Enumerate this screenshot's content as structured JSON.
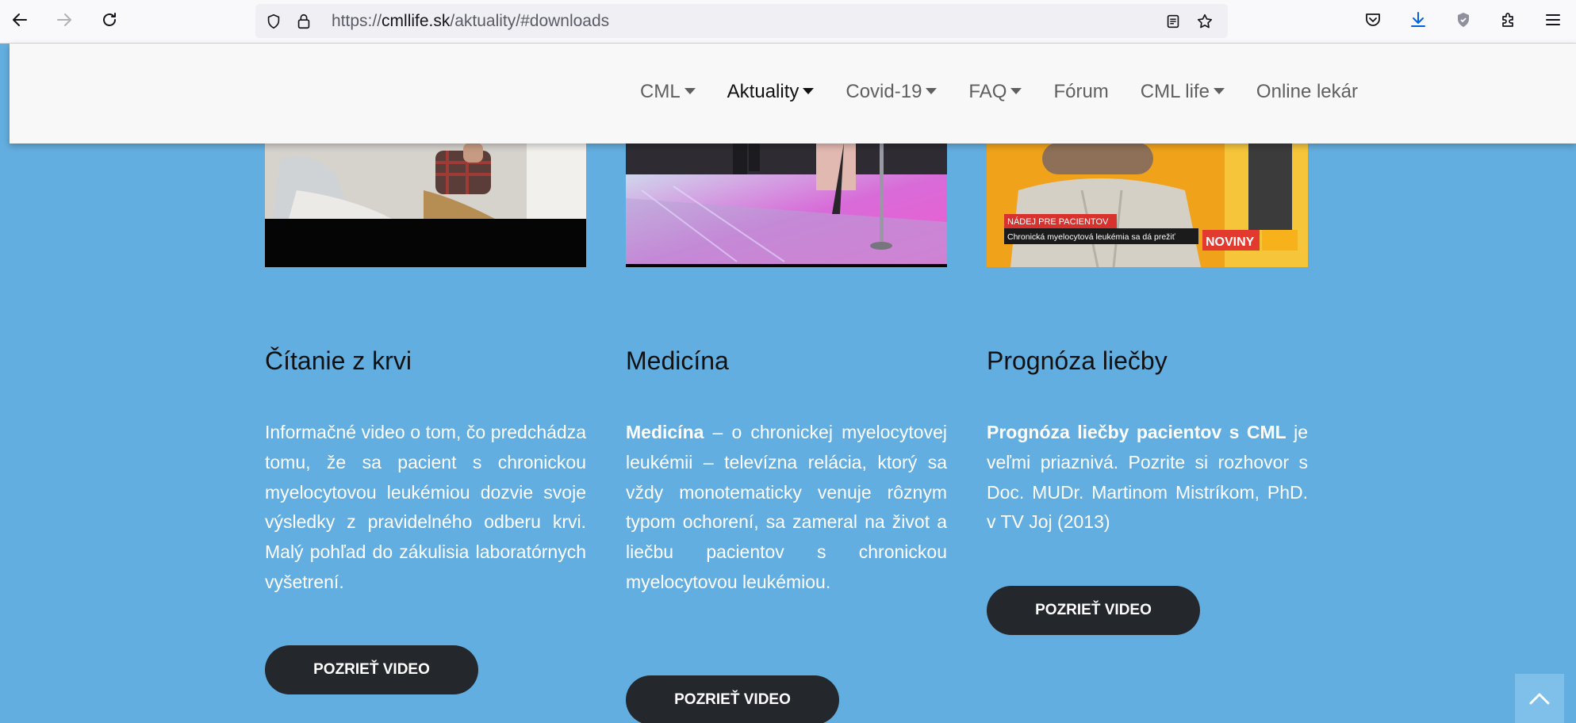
{
  "browser": {
    "url_scheme": "https://",
    "url_host": "cmllife.sk",
    "url_path": "/aktuality/#downloads"
  },
  "site_nav": [
    {
      "label": "CML",
      "dropdown": true,
      "active": false
    },
    {
      "label": "Aktuality",
      "dropdown": true,
      "active": true
    },
    {
      "label": "Covid-19",
      "dropdown": true,
      "active": false
    },
    {
      "label": "FAQ",
      "dropdown": true,
      "active": false
    },
    {
      "label": "Fórum",
      "dropdown": false,
      "active": false
    },
    {
      "label": "CML life",
      "dropdown": true,
      "active": false
    },
    {
      "label": "Online lekár",
      "dropdown": false,
      "active": false
    }
  ],
  "cards": [
    {
      "title": "Čítanie z krvi",
      "text_bold": "",
      "text": "Informačné video o tom, čo predchádza tomu, že sa pacient s chronickou myelocytovou leukémiou dozvie svoje výsledky z pravidelného odberu krvi. Malý pohľad do zákulisia laboratórnych vyšetrení.",
      "button": "POZRIEŤ VIDEO"
    },
    {
      "title": "Medicína",
      "text_bold": "Medicína",
      "text": " – o chronickej myelocytovej leukémii – televízna relácia, ktorý sa vždy monotematicky venuje rôznym typom ochorení, sa zameral na život a liečbu pacientov s chronickou myelocytovou leukémiou.",
      "button": "POZRIEŤ VIDEO"
    },
    {
      "title": "Prognóza liečby",
      "text_bold": "Prognóza liečby pacientov s CML",
      "text": " je veľmi priaznivá. Pozrite si rozhovor s Doc. MUDr. Martinom Mistríkom, PhD. v  TV Joj (2013)",
      "button": "POZRIEŤ VIDEO"
    }
  ],
  "thumb3_overlay": {
    "tag": "NÁDEJ PRE PACIENTOV",
    "caption": "Chronická myelocytová leukémia sa dá prežiť",
    "brand": "NOVINY"
  },
  "colors": {
    "page_bg": "#63aee0",
    "button_bg": "#24272b",
    "header_bg": "#f8f8f8"
  }
}
